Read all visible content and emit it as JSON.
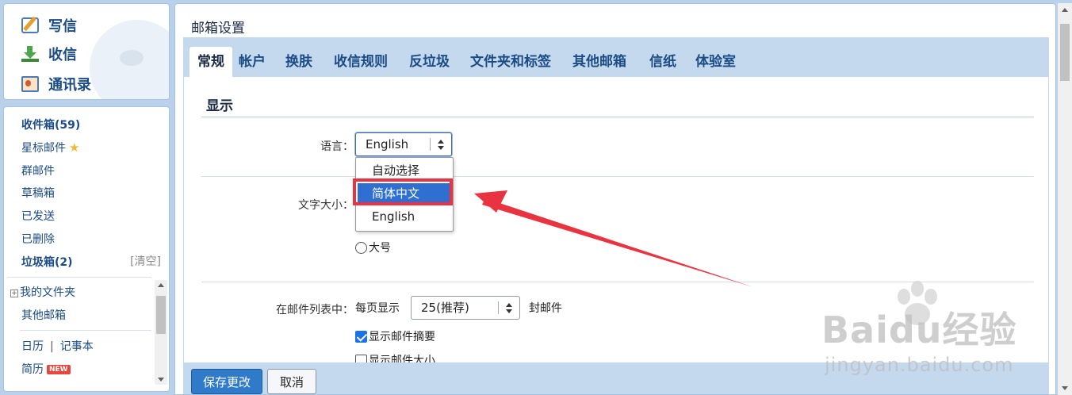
{
  "quick_actions": {
    "write": "写信",
    "receive": "收信",
    "contacts": "通讯录"
  },
  "folders": {
    "inbox": "收件箱(59)",
    "starred": "星标邮件",
    "group": "群邮件",
    "drafts": "草稿箱",
    "sent": "已发送",
    "deleted": "已删除",
    "spam": "垃圾箱(2)",
    "spam_clear": "[清空]",
    "my_folders": "我的文件夹",
    "other_mailboxes": "其他邮箱",
    "calendar": "日历",
    "separator": "|",
    "notepad": "记事本",
    "resume": "简历",
    "new_badge": "NEW"
  },
  "page": {
    "title": "邮箱设置"
  },
  "tabs": [
    {
      "label": "常规",
      "active": true
    },
    {
      "label": "帐户"
    },
    {
      "label": "换肤"
    },
    {
      "label": "收信规则"
    },
    {
      "label": "反垃圾"
    },
    {
      "label": "文件夹和标签"
    },
    {
      "label": "其他邮箱"
    },
    {
      "label": "信纸"
    },
    {
      "label": "体验室"
    }
  ],
  "display_section": {
    "title": "显示",
    "language_label": "语言：",
    "language_value": "English",
    "language_options": [
      "自动选择",
      "简体中文",
      "English"
    ],
    "language_highlighted": "简体中文",
    "font_size_label": "文字大小：",
    "font_size_large": "大号",
    "mail_list_label": "在邮件列表中：",
    "per_page_prefix": "每页显示",
    "per_page_value": "25(推荐)",
    "per_page_suffix": "封邮件",
    "show_summary": "显示邮件摘要",
    "show_size": "显示邮件大小"
  },
  "footer": {
    "save": "保存更改",
    "cancel": "取消"
  },
  "watermark": {
    "brand": "Baidu经验",
    "url": "jingyan.baidu.com"
  },
  "colors": {
    "accent": "#1b4c86",
    "tab_bar": "#c4d8ee",
    "selected_option": "#2f6fd1",
    "annotation": "#ea3340"
  }
}
